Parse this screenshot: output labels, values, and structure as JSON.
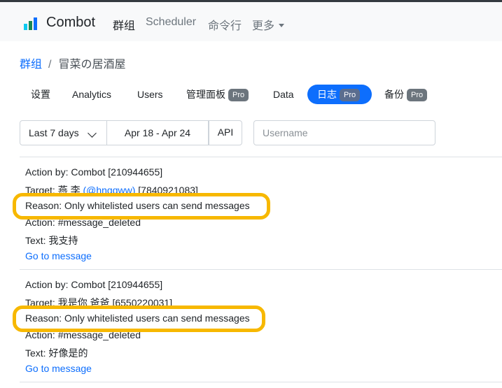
{
  "navbar": {
    "brand": "Combot",
    "links": [
      "群组",
      "Scheduler",
      "命令行",
      "更多"
    ],
    "logo_colors": [
      "#0dcaf0",
      "#198754",
      "#0d6efd"
    ]
  },
  "breadcrumb": {
    "root": "群组",
    "separator": "/",
    "current": "冒菜の居酒屋"
  },
  "tabs": [
    {
      "label": "设置",
      "pro": ""
    },
    {
      "label": "Analytics",
      "pro": ""
    },
    {
      "label": "Users",
      "pro": ""
    },
    {
      "label": "管理面板",
      "pro": "Pro"
    },
    {
      "label": "Data",
      "pro": ""
    },
    {
      "label": "日志",
      "pro": "Pro",
      "active": true
    },
    {
      "label": "备份",
      "pro": "Pro"
    }
  ],
  "filters": {
    "range": "Last 7 days",
    "dates": "Apr 18 - Apr 24",
    "api": "API",
    "username_placeholder": "Username"
  },
  "log_entries": [
    {
      "action_by": "Action by: Combot [210944655]",
      "target_prefix": "Target: 燕 李 ",
      "target_handle": "(@hnqqww)",
      "target_suffix": " [7840921083]",
      "reason": "Reason: Only whitelisted users can send messages",
      "action": "Action: #message_deleted",
      "text": "Text: 我支持",
      "link": "Go to message"
    },
    {
      "action_by": "Action by: Combot [210944655]",
      "target": "Target: 我是你 爸爸 [6550220031]",
      "reason": "Reason: Only whitelisted users can send messages",
      "action": "Action: #message_deleted",
      "text": "Text: 好像是的",
      "link": "Go to message"
    }
  ],
  "colors": {
    "accent": "#0d6efd",
    "highlight": "#f7b800"
  }
}
